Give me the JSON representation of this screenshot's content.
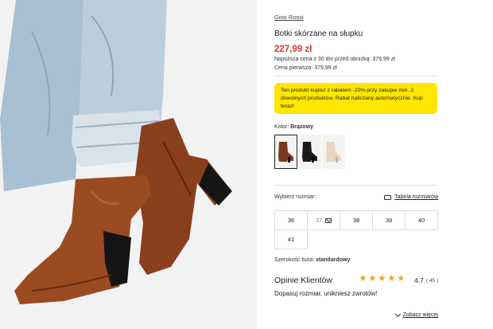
{
  "product": {
    "brand": "Gino Rossi",
    "title": "Botki skórzane na słupku",
    "price": "227,99 zł",
    "lowest_price": "Najniższa cena z 30 dni przed obniżką: 379,99 zł",
    "first_price": "Cena pierwsza: 379,99 zł"
  },
  "promo": {
    "text": "Ten produkt kupisz z rabatem -20% przy zakupie min. 2 dowolnych produktów. Rabat naliczany automatycznie. Kup teraz!"
  },
  "color": {
    "label": "Kolor:",
    "value": "Brązowy",
    "swatches": [
      {
        "name": "brown",
        "hex": "#7a3a1e",
        "selected": true
      },
      {
        "name": "black",
        "hex": "#1a1a1a",
        "selected": false
      },
      {
        "name": "beige",
        "hex": "#e6d6c2",
        "selected": false
      }
    ]
  },
  "size": {
    "label": "Wybierz rozmiar:",
    "guide_label": "Tabela rozmiarów",
    "options": [
      {
        "label": "36",
        "available": true
      },
      {
        "label": "37",
        "available": false
      },
      {
        "label": "38",
        "available": true
      },
      {
        "label": "39",
        "available": true
      },
      {
        "label": "40",
        "available": true
      },
      {
        "label": "41",
        "available": true
      }
    ]
  },
  "width": {
    "label": "Szerokość buta:",
    "value": "standardowy"
  },
  "reviews": {
    "title": "Opinie Klientów",
    "rating": "4.7",
    "count": "( 45 )",
    "stars": 4.7,
    "tagline": "Dopasuj rozmiar, unikniesz zwrotów!",
    "more_label": "Zobacz więcej"
  },
  "colors": {
    "accent_red": "#d6372e",
    "promo_yellow": "#ffe600",
    "star": "#f5a623"
  }
}
